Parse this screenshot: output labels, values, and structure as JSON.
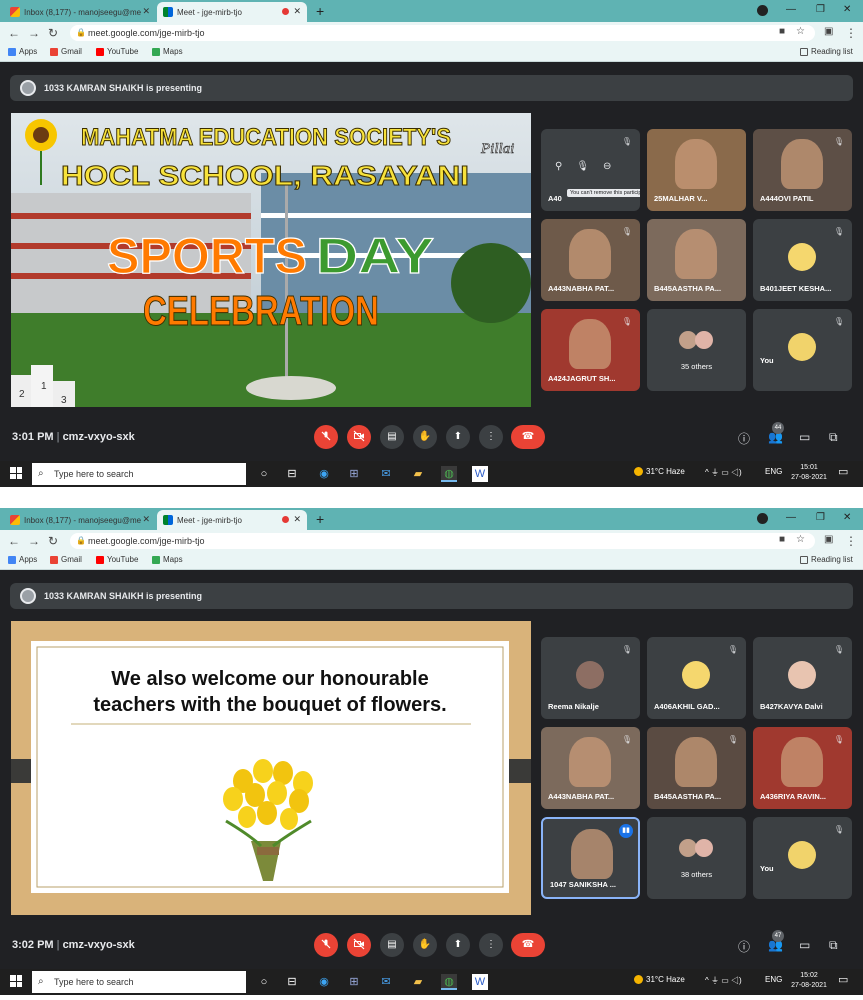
{
  "colors": {
    "tab_strip": "#5fb3b3",
    "meet_background": "#202124",
    "tile_background": "#3c4043",
    "mute_red": "#ea4335",
    "speaking_blue": "#1a73e8",
    "taskbar": "#1f1f1f",
    "slide1_title_yellow": "#f7e23b",
    "slide1_sports_orange": "#ff7a00",
    "slide1_day_green": "#3c9a2f"
  },
  "shots": [
    {
      "tabs": {
        "inactive_title": "Inbox (8,177) - manojseegu@me",
        "active_title": "Meet - jge-mirb-tjo",
        "new_tab_icon": "plus-icon"
      },
      "address": {
        "url": "meet.google.com/jge-mirb-tjo"
      },
      "bookmarks": {
        "apps": "Apps",
        "gmail": "Gmail",
        "youtube": "YouTube",
        "maps": "Maps",
        "reading_list": "Reading list"
      },
      "banner": {
        "text": "1033 KAMRAN SHAIKH is presenting"
      },
      "slide": {
        "kind": "sports",
        "line1": "MAHATMA EDUCATION SOCIETY'S",
        "line2": "HOCL SCHOOL, RASAYANI",
        "signature": "Pillai",
        "sports": "SPORTS",
        "day": "DAY",
        "celebration": "CELEBRATION",
        "podium": [
          "1",
          "2",
          "3"
        ]
      },
      "tiles": [
        {
          "name": "A40",
          "muted": true,
          "type": "hover",
          "tooltip": "You can't remove this participant"
        },
        {
          "name": "25MALHAR V...",
          "muted": false,
          "type": "video"
        },
        {
          "name": "A444OVI PATIL",
          "muted": true,
          "type": "video"
        },
        {
          "name": "A443NABHA PAT...",
          "muted": true,
          "type": "video"
        },
        {
          "name": "B445AASTHA PA...",
          "muted": false,
          "type": "video"
        },
        {
          "name": "B401JEET KESHA...",
          "muted": true,
          "type": "avatar"
        },
        {
          "name": "A424JAGRUT SH...",
          "muted": true,
          "type": "video"
        },
        {
          "name": "35 others",
          "muted": false,
          "type": "others"
        },
        {
          "name": "You",
          "muted": true,
          "type": "you"
        }
      ],
      "bottom": {
        "time": "3:01 PM",
        "separator": "|",
        "code": "cmz-vxyo-sxk",
        "people_count": "44"
      },
      "taskbar": {
        "search": "Type here to search",
        "weather": "31°C Haze",
        "lang": "ENG",
        "time": "15:01",
        "date": "27-08-2021"
      }
    },
    {
      "tabs": {
        "inactive_title": "Inbox (8,177) - manojseegu@me",
        "active_title": "Meet - jge-mirb-tjo",
        "new_tab_icon": "plus-icon"
      },
      "address": {
        "url": "meet.google.com/jge-mirb-tjo"
      },
      "bookmarks": {
        "apps": "Apps",
        "gmail": "Gmail",
        "youtube": "YouTube",
        "maps": "Maps",
        "reading_list": "Reading list"
      },
      "banner": {
        "text": "1033 KAMRAN SHAIKH is presenting"
      },
      "slide": {
        "kind": "teachers",
        "line1": "We also welcome our honourable",
        "line2": "teachers with the bouquet of flowers."
      },
      "tiles": [
        {
          "name": "Reema Nikalje",
          "muted": true,
          "type": "avatar"
        },
        {
          "name": "A406AKHIL GAD...",
          "muted": true,
          "type": "avatar"
        },
        {
          "name": "B427KAVYA Dalvi",
          "muted": true,
          "type": "avatar"
        },
        {
          "name": "A443NABHA PAT...",
          "muted": true,
          "type": "video"
        },
        {
          "name": "B445AASTHA PA...",
          "muted": true,
          "type": "video"
        },
        {
          "name": "A436RIYA RAVIN...",
          "muted": true,
          "type": "video"
        },
        {
          "name": "1047 SANIKSHA ...",
          "muted": false,
          "type": "speaking"
        },
        {
          "name": "38 others",
          "muted": false,
          "type": "others"
        },
        {
          "name": "You",
          "muted": true,
          "type": "you"
        }
      ],
      "bottom": {
        "time": "3:02 PM",
        "separator": "|",
        "code": "cmz-vxyo-sxk",
        "people_count": "47"
      },
      "taskbar": {
        "search": "Type here to search",
        "weather": "31°C Haze",
        "lang": "ENG",
        "time": "15:02",
        "date": "27-08-2021"
      }
    }
  ]
}
